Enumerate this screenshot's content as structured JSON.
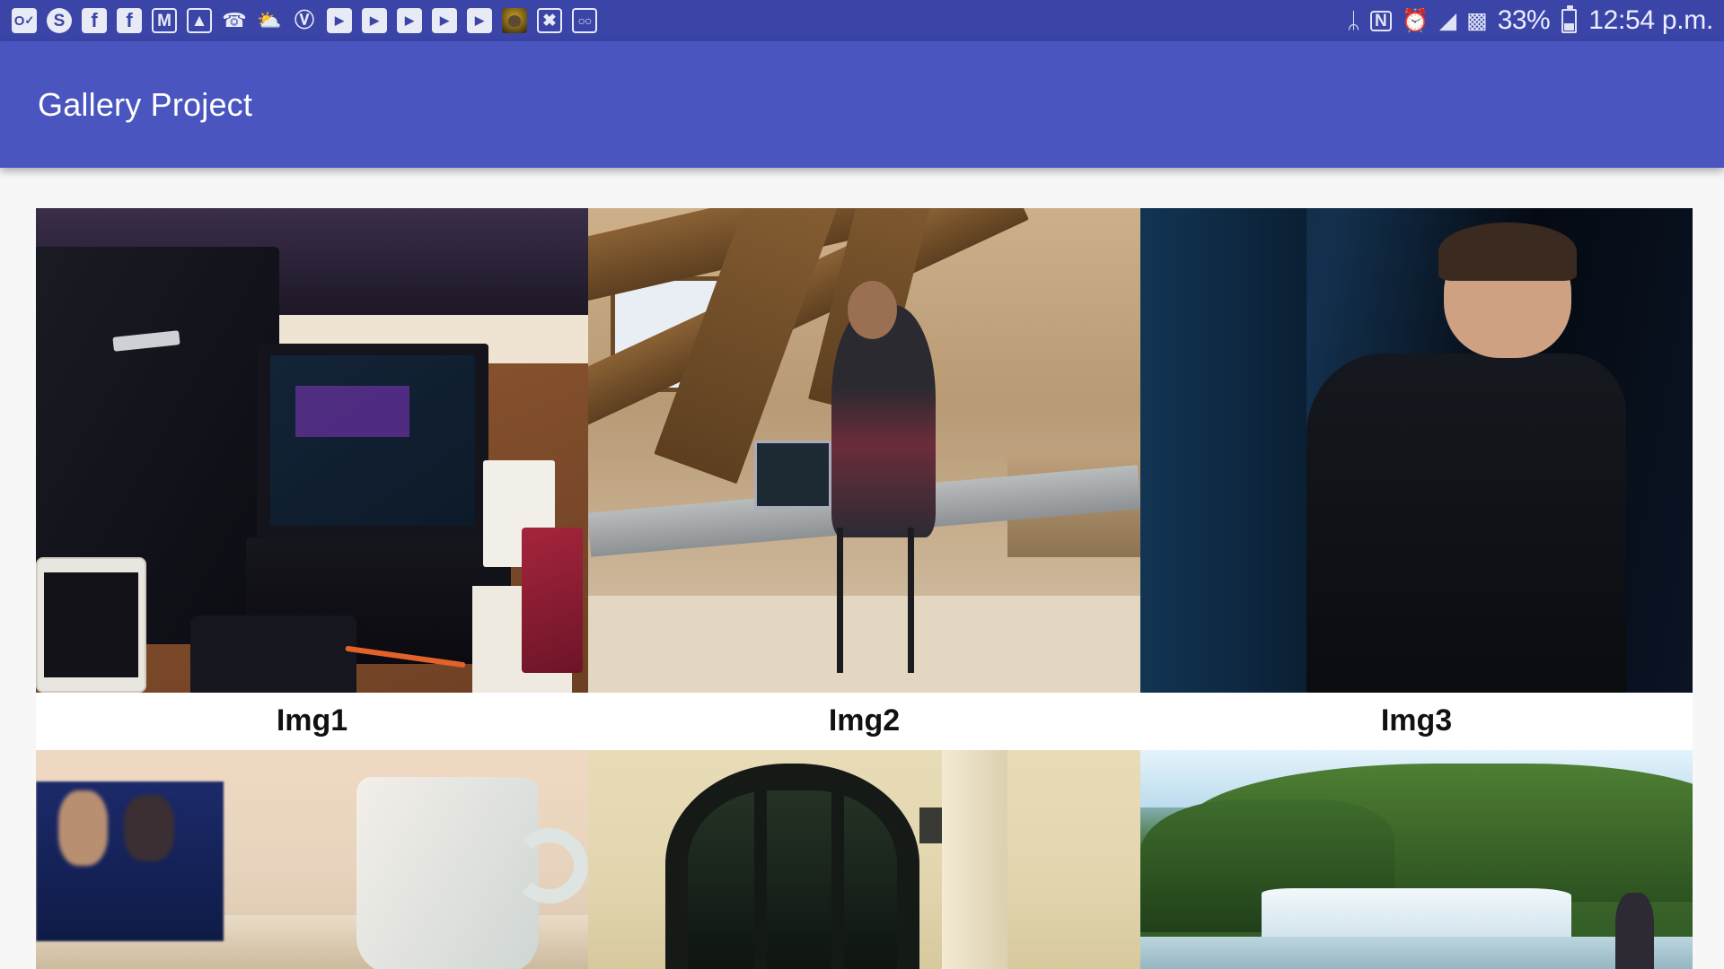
{
  "status_bar": {
    "background_color": "#3b45a8",
    "notification_icons": [
      {
        "name": "outlook-icon",
        "glyph": "O"
      },
      {
        "name": "skype-icon",
        "glyph": "S"
      },
      {
        "name": "facebook-icon",
        "glyph": "f"
      },
      {
        "name": "facebook-icon-2",
        "glyph": "f"
      },
      {
        "name": "gmail-icon",
        "glyph": "M"
      },
      {
        "name": "photos-icon",
        "glyph": "◩"
      },
      {
        "name": "missed-call-icon",
        "glyph": "⌕"
      },
      {
        "name": "weather-icon",
        "glyph": "⛅"
      },
      {
        "name": "pinterest-icon",
        "glyph": "P"
      },
      {
        "name": "youtube-icon-1",
        "glyph": "▶"
      },
      {
        "name": "youtube-icon-2",
        "glyph": "▶"
      },
      {
        "name": "youtube-icon-3",
        "glyph": "▶"
      },
      {
        "name": "youtube-icon-4",
        "glyph": "▶"
      },
      {
        "name": "youtube-icon-5",
        "glyph": "▶"
      },
      {
        "name": "avatar-icon",
        "glyph": ""
      },
      {
        "name": "mail-x-icon",
        "glyph": "✕"
      },
      {
        "name": "voicemail-icon",
        "glyph": "∞"
      }
    ],
    "system_icons": [
      {
        "name": "bluetooth-icon",
        "glyph": "ᛦ"
      },
      {
        "name": "nfc-icon",
        "glyph": "N"
      },
      {
        "name": "alarm-icon",
        "glyph": "⏰"
      },
      {
        "name": "wifi-icon",
        "glyph": "▲"
      },
      {
        "name": "signal-icon",
        "glyph": "▐"
      }
    ],
    "battery_percent": "33%",
    "clock": "12:54 p.m."
  },
  "app_bar": {
    "title": "Gallery Project",
    "background_color": "#4a55c0",
    "text_color": "#ffffff"
  },
  "gallery": {
    "columns": 3,
    "items": [
      {
        "name": "gallery-item-1",
        "caption": "Img1",
        "alt": "Desk with tablet keyboard, backpack and smartphone",
        "style": "p1",
        "has_caption": true
      },
      {
        "name": "gallery-item-2",
        "caption": "Img2",
        "alt": "Person working at attic desk with wooden beams",
        "style": "p2",
        "has_caption": true
      },
      {
        "name": "gallery-item-3",
        "caption": "Img3",
        "alt": "Portrait of man in dark shirt by blue wall",
        "style": "p3",
        "has_caption": true
      },
      {
        "name": "gallery-item-4",
        "caption": "",
        "alt": "Coffee mug on cafe table",
        "style": "p4",
        "has_caption": false
      },
      {
        "name": "gallery-item-5",
        "caption": "",
        "alt": "Building facade with arched doorway",
        "style": "p5",
        "has_caption": false
      },
      {
        "name": "gallery-item-6",
        "caption": "",
        "alt": "Waterfall landscape with green forest",
        "style": "p6",
        "has_caption": false
      }
    ]
  }
}
